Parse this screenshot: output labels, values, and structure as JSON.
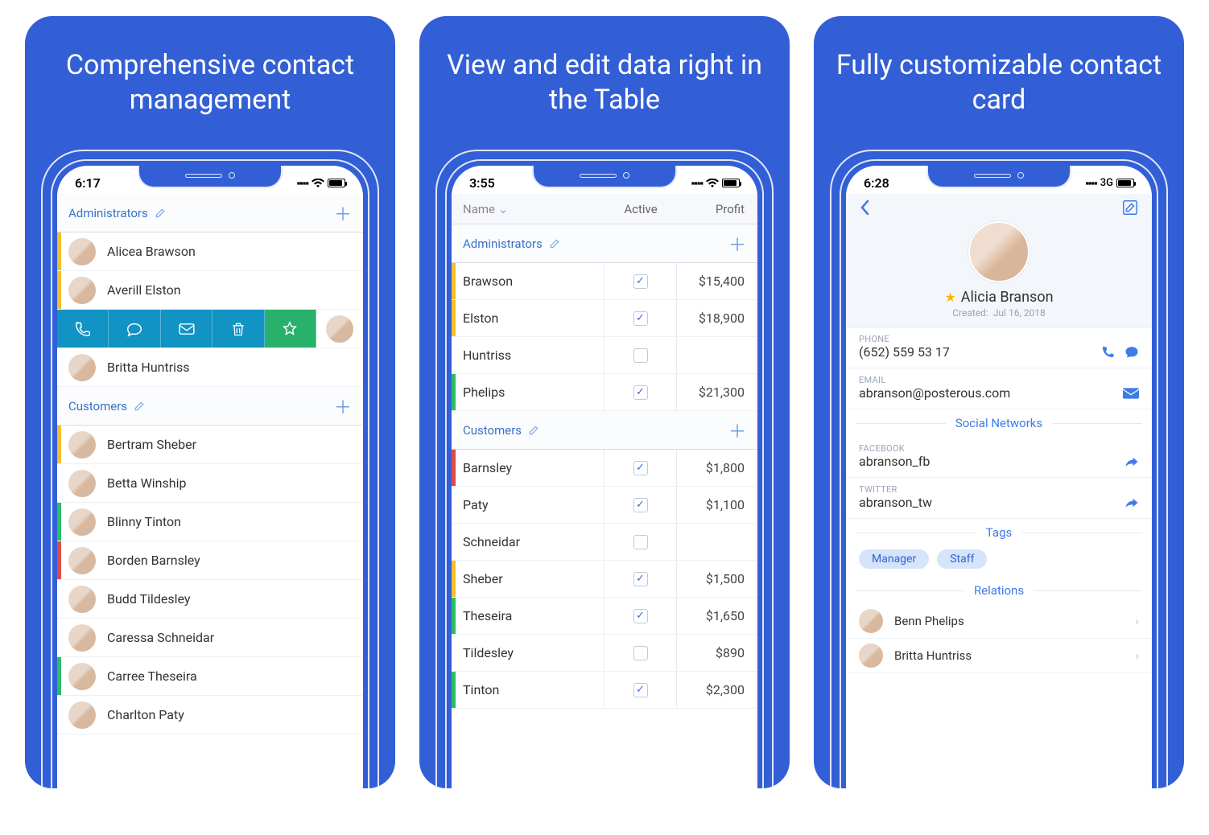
{
  "panels": [
    {
      "title": "Comprehensive contact management"
    },
    {
      "title": "View and edit data right in the Table"
    },
    {
      "title": "Fully customizable contact card"
    }
  ],
  "screen1": {
    "time": "6:17",
    "sections": [
      {
        "title": "Administrators",
        "rows": [
          {
            "name": "Alicea Brawson",
            "color": "c-yellow"
          },
          {
            "name": "Averill Elston",
            "color": "c-yellow"
          },
          {
            "name": "__swipe__",
            "color": ""
          },
          {
            "name": "Britta Huntriss",
            "color": "c-none"
          }
        ]
      },
      {
        "title": "Customers",
        "rows": [
          {
            "name": "Bertram Sheber",
            "color": "c-yellow"
          },
          {
            "name": "Betta Winship",
            "color": "c-none"
          },
          {
            "name": "Blinny Tinton",
            "color": "c-green"
          },
          {
            "name": "Borden Barnsley",
            "color": "c-red"
          },
          {
            "name": "Budd Tildesley",
            "color": "c-none"
          },
          {
            "name": "Caressa Schneidar",
            "color": "c-none"
          },
          {
            "name": "Carree Theseira",
            "color": "c-green"
          },
          {
            "name": "Charlton Paty",
            "color": "c-none"
          }
        ]
      }
    ]
  },
  "screen2": {
    "time": "3:55",
    "columns": {
      "c1": "Name",
      "c2": "Active",
      "c3": "Profit"
    },
    "sections": [
      {
        "title": "Administrators",
        "rows": [
          {
            "name": "Brawson",
            "active": true,
            "profit": "$15,400",
            "color": "c-yellow"
          },
          {
            "name": "Elston",
            "active": true,
            "profit": "$18,900",
            "color": "c-yellow"
          },
          {
            "name": "Huntriss",
            "active": false,
            "profit": "",
            "color": "c-none"
          },
          {
            "name": "Phelips",
            "active": true,
            "profit": "$21,300",
            "color": "c-green"
          }
        ]
      },
      {
        "title": "Customers",
        "rows": [
          {
            "name": "Barnsley",
            "active": true,
            "profit": "$1,800",
            "color": "c-red"
          },
          {
            "name": "Paty",
            "active": true,
            "profit": "$1,100",
            "color": "c-none"
          },
          {
            "name": "Schneidar",
            "active": false,
            "profit": "",
            "color": "c-none"
          },
          {
            "name": "Sheber",
            "active": true,
            "profit": "$1,500",
            "color": "c-yellow"
          },
          {
            "name": "Theseira",
            "active": true,
            "profit": "$1,650",
            "color": "c-green"
          },
          {
            "name": "Tildesley",
            "active": false,
            "profit": "$890",
            "color": "c-none"
          },
          {
            "name": "Tinton",
            "active": true,
            "profit": "$2,300",
            "color": "c-green"
          }
        ]
      }
    ]
  },
  "screen3": {
    "time": "6:28",
    "network": "3G",
    "name": "Alicia Branson",
    "created_label": "Created:",
    "created_value": "Jul 16, 2018",
    "phone_label": "PHONE",
    "phone": "(652) 559 53 17",
    "email_label": "EMAIL",
    "email": "abranson@posterous.com",
    "social_header": "Social Networks",
    "facebook_label": "FACEBOOK",
    "facebook": "abranson_fb",
    "twitter_label": "TWITTER",
    "twitter": "abranson_tw",
    "tags_header": "Tags",
    "tags": [
      "Manager",
      "Staff"
    ],
    "relations_header": "Relations",
    "relations": [
      "Benn Phelips",
      "Britta Huntriss"
    ]
  }
}
